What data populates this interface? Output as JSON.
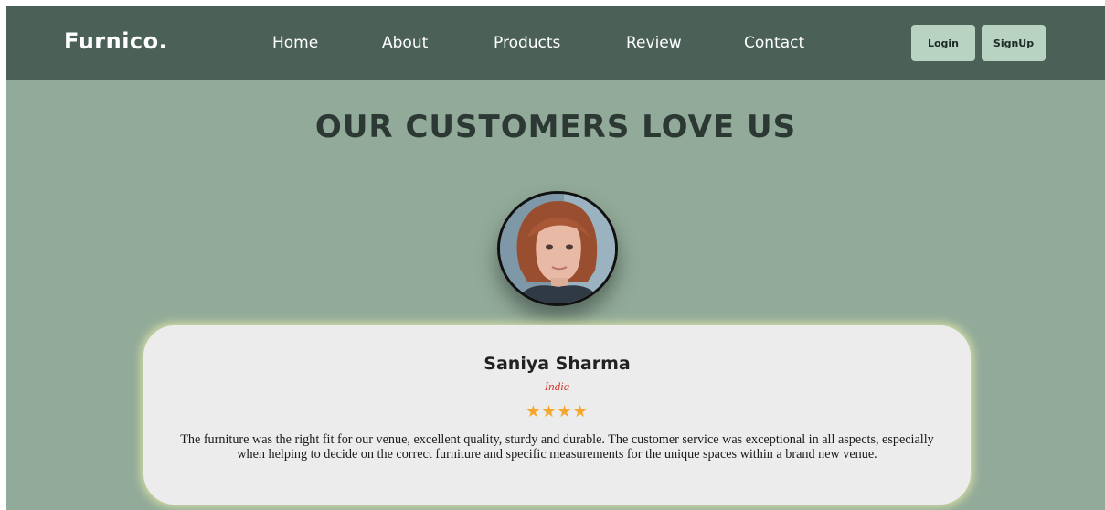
{
  "navbar": {
    "brand": "Furnico.",
    "links": [
      {
        "label": "Home"
      },
      {
        "label": "About"
      },
      {
        "label": "Products"
      },
      {
        "label": "Review"
      },
      {
        "label": "Contact"
      }
    ],
    "login_label": "Login",
    "signup_label": "SignUp"
  },
  "section": {
    "heading": "OUR CUSTOMERS LOVE US"
  },
  "testimonial": {
    "name": "Saniya Sharma",
    "country": "India",
    "rating": 4,
    "stars": "★★★★",
    "review": "The furniture was the right fit for our venue, excellent quality, sturdy and durable. The customer service was exceptional in all aspects, especially when helping to decide on the correct furniture and specific measurements for the unique spaces within a brand new venue."
  },
  "colors": {
    "navbar_bg": "#4b6158",
    "page_bg": "#92aa99",
    "button_bg": "#b9d3c3",
    "card_bg": "#ececec",
    "star": "#f4a830",
    "country_text": "#d23a32"
  },
  "icons": {
    "avatar": "customer-photo"
  }
}
